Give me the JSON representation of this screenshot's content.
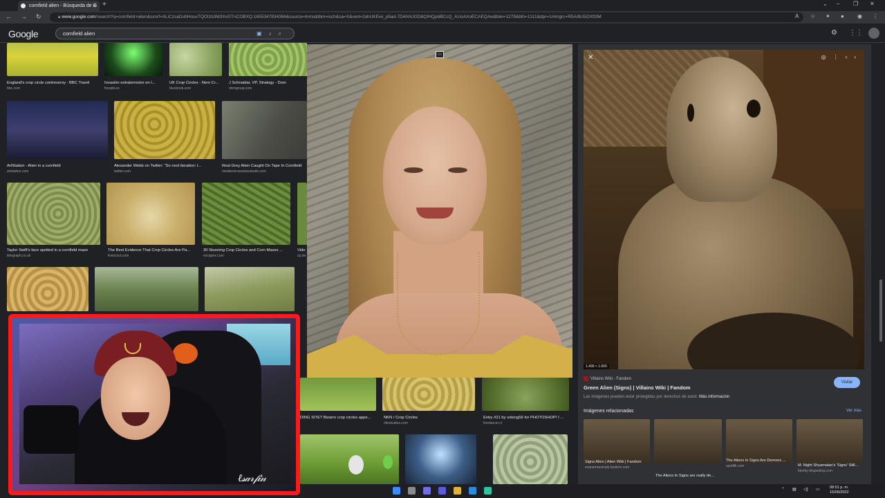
{
  "browser": {
    "tab_title": "cornfield alien - Búsqueda de G",
    "url_host": "www.google.com",
    "url_rest": "/search?q=cornfield+alien&sxsrf=ALiCzsaDuhHouvTQOl1b3M3XvGTnCOBXQ:1655347834366&source=lnms&tbm=isch&sa=X&ved=2ahUKEwi_p5ad-7D4AhUGD8QIHQpbBCcQ_AUoAXoECAEQAw&biw=1278&bih=1311&dpr=1#imgrc=R5A/8U5OXft3M"
  },
  "google": {
    "logo": "Google",
    "query": "cornfield alien"
  },
  "grid": [
    {
      "caption": "England's crop circle controversy - BBC Travel",
      "source": "bbc.com"
    },
    {
      "caption": "Invasión extraterrestre en l...",
      "source": "freepik.es"
    },
    {
      "caption": "UK Crop Circles - Nem Cr...",
      "source": "facebook.com"
    },
    {
      "caption": "J Schnaidar, VP, Strategy - Dom",
      "source": "domgroup.com"
    },
    {
      "caption": "ArtStation - Alien in a cornfield",
      "source": "artstation.com"
    },
    {
      "caption": "Alexander Webb on Twitter: \"So next iteration: I...",
      "source": "twitter.com"
    },
    {
      "caption": "Real Grey Alien Caught On Tape In Cornfield",
      "source": "metaleverseaelanstudio.com"
    },
    {
      "caption": "Taylor Swift's face spotted in a cornfield maze",
      "source": "telegraph.co.uk"
    },
    {
      "caption": "The Best Evidence That Crop Circles Are Pa...",
      "source": "livescout.com"
    },
    {
      "caption": "30 Stunning Crop Circles and Corn Mazes ...",
      "source": "escquire.com"
    },
    {
      "caption": "Vide",
      "source": "cp.de"
    },
    {
      "caption": "DING SITE? Bizarre crop circles appe...",
      "source": ""
    },
    {
      "caption": "NKN / Crop Circles",
      "source": "nknstudios.com"
    },
    {
      "caption": "Entry #21 by vokingS6 for PHOTOSHOP! I ...",
      "source": "freelancer.cl"
    }
  ],
  "preview": {
    "dimensions": "1.499 × 1.600",
    "site": "Villains Wiki - Fandom",
    "title": "Green Alien (Signs) | Villains Wiki | Fandom",
    "visit_label": "Visitar",
    "note": "Las imágenes pueden estar protegidas por derechos de autor.",
    "more_info": "Más información",
    "related_title": "Imágenes relacionadas",
    "see_more": "Ver más",
    "related": [
      {
        "caption": "Signs Alien | Alien Wiki | Fandom",
        "source": "evanemrestrials.fandom.com"
      },
      {
        "caption": "The Aliens In Signs are really de...",
        "source": ""
      },
      {
        "caption": "The Aliens In Signs Are Demons ...",
        "source": "spotfilk.com"
      },
      {
        "caption": "M. Night Shyamalan's 'Signs' Still...",
        "source": "bloody-disgusting.com"
      }
    ]
  },
  "taskbar": {
    "time": "08:51 p. m.",
    "date": "15/06/2022"
  },
  "colors": {
    "accent": "#8ab4f8",
    "webcam_border": "#ff1a1a",
    "background": "#202124"
  }
}
